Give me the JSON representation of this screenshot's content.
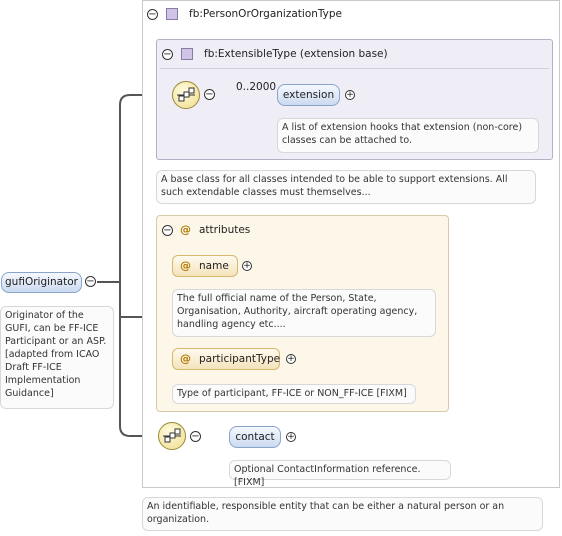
{
  "root": {
    "name": "gufiOriginator",
    "collapse_symbol": "⊖",
    "doc": "Originator of the GUFI, can be FF-ICE Participant or an ASP. [adapted from ICAO Draft FF-ICE Implementation Guidance]"
  },
  "type": {
    "name": "fb:PersonOrOrganizationType",
    "doc": "An identifiable, responsible entity that can be either a natural person or an organization."
  },
  "extension_base": {
    "name": "fb:ExtensibleType (extension base)",
    "doc": "A base class for all classes intended to be able to support extensions. All such extendable classes must themselves...",
    "element": {
      "cardinality": "0..2000",
      "name": "extension",
      "doc": "A list of extension hooks that extension (non-core) classes can be attached to."
    }
  },
  "attributes": {
    "title": "attributes",
    "at_symbol": "@",
    "items": [
      {
        "name": "name",
        "doc": "The full official name of the Person, State, Organisation, Authority, aircraft operating agency, handling agency etc...."
      },
      {
        "name": "participantType",
        "doc": "Type of participant, FF-ICE or NON_FF-ICE [FIXM]"
      }
    ]
  },
  "contact": {
    "name": "contact",
    "doc": "Optional ContactInformation reference.[FIXM]"
  },
  "symbols": {
    "collapse": "−",
    "expand": "+"
  },
  "colors": {
    "line": "#555555",
    "pill_border": "#8aa4c9",
    "attr_fill": "#fdf7ea",
    "type_fill": "#efedf6"
  },
  "icons": [
    "sequence-compositor-icon",
    "complex-type-icon",
    "collapse-icon",
    "expand-icon"
  ]
}
